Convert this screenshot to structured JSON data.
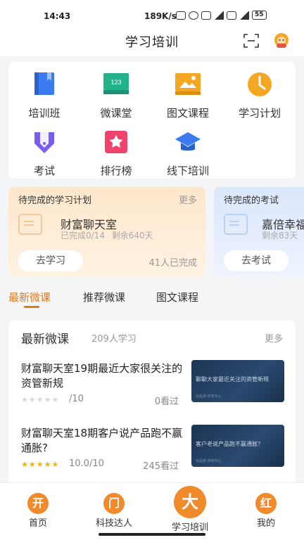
{
  "status_bar": {
    "time": "14:43",
    "network_speed": "189K/s",
    "battery": "55"
  },
  "header": {
    "title": "学习培训",
    "scan_icon": "scan-icon",
    "avatar_icon": "avatar-icon"
  },
  "grid": [
    {
      "label": "培训班",
      "icon": "book-icon",
      "color": "#3a7cf0"
    },
    {
      "label": "微课堂",
      "icon": "screen-icon",
      "color": "#22b38a"
    },
    {
      "label": "图文课程",
      "icon": "image-icon",
      "color": "#f5a623"
    },
    {
      "label": "学习计划",
      "icon": "clock-icon",
      "color": "#f5a623"
    },
    {
      "label": "考试",
      "icon": "pen-icon",
      "color": "#7b5cf0"
    },
    {
      "label": "排行榜",
      "icon": "star-icon",
      "color": "#f0436b"
    },
    {
      "label": "线下培训",
      "icon": "graduation-cap-icon",
      "color": "#3a7cf0"
    }
  ],
  "study_plan": {
    "heading": "待完成的学习计划",
    "more": "更多",
    "name": "财富聊天室",
    "progress": "已完成0/14",
    "remaining": "剩余640天",
    "button": "去学习",
    "completed_count": "41人已完成"
  },
  "exam": {
    "heading": "待完成的考试",
    "name": "嘉倍幸福",
    "remaining": "剩余83天",
    "button": "去考试"
  },
  "tabs": [
    "最新微课",
    "推荐微课",
    "图文课程"
  ],
  "course_section": {
    "title": "最新微课",
    "count": "209人学习",
    "more": "更多",
    "items": [
      {
        "title": "财富聊天室19期最近大家很关注的资管新规",
        "rating": 0,
        "score": "/10",
        "views": "0看过",
        "thumb_title": "聊聊大家最近关注的资管新规",
        "thumb_sub": "出品部·资管中心"
      },
      {
        "title": "财富聊天室18期客户说产品跑不赢通胀?",
        "rating": 5,
        "score": "10.0/10",
        "views": "245看过",
        "thumb_title": "客户老说产品跑不赢通胀？",
        "thumb_sub": "出品部·资管中心"
      }
    ]
  },
  "bottom_nav": [
    {
      "badge": "开",
      "label": "首页"
    },
    {
      "badge": "门",
      "label": "科技达人"
    },
    {
      "badge": "大",
      "label": "学习培训"
    },
    {
      "badge": "红",
      "label": "我的"
    }
  ],
  "colors": {
    "accent": "#e07a1d",
    "badge": "#f08a2a",
    "star_on": "#f5b400",
    "star_off": "#d8d8d8"
  }
}
